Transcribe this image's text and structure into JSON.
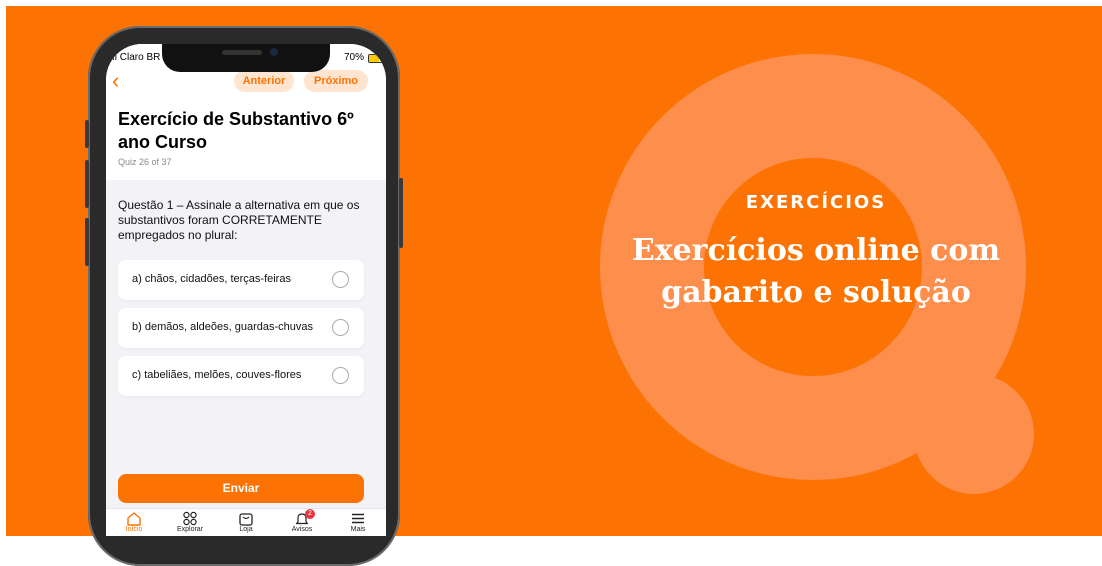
{
  "banner": {
    "eyebrow": "EXERCÍCIOS",
    "headline_line1": "Exercícios online com",
    "headline_line2": "gabarito e solução",
    "colors": {
      "background": "#FC7304",
      "q_letter": "#FD8E4B"
    }
  },
  "phone": {
    "status": {
      "carrier": "Claro BR",
      "battery": "70%"
    },
    "nav": {
      "back_icon": "chevron-left-icon",
      "prev_label": "Anterior",
      "next_label": "Próximo"
    },
    "quiz": {
      "title": "Exercício de Substantivo 6º ano Curso",
      "progress": "Quiz 26 of 37",
      "question": "Questão 1 – Assinale a alternativa em que os substantivos foram CORRETAMENTE empregados no plural:",
      "options": [
        {
          "label": "a) chãos, cidadões, terças-feiras",
          "selected": false
        },
        {
          "label": "b) demãos, aldeões, guardas-chuvas",
          "selected": false
        },
        {
          "label": "c) tabeliães, melões, couves-flores",
          "selected": false
        }
      ],
      "submit_label": "Enviar"
    },
    "tabbar": {
      "items": [
        {
          "label": "Início",
          "icon": "home-icon",
          "active": true
        },
        {
          "label": "Explorar",
          "icon": "grid-icon",
          "active": false
        },
        {
          "label": "Loja",
          "icon": "store-icon",
          "active": false
        },
        {
          "label": "Avisos",
          "icon": "bell-icon",
          "active": false,
          "badge": "2"
        },
        {
          "label": "Mais",
          "icon": "menu-icon",
          "active": false
        }
      ]
    }
  }
}
